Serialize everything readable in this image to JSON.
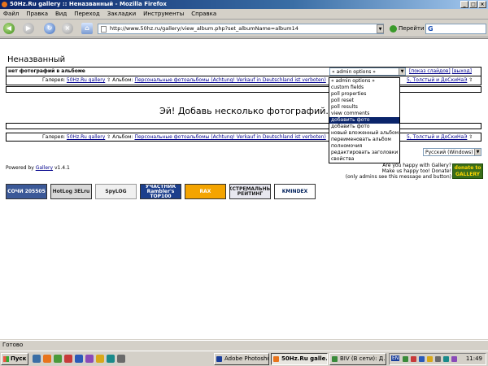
{
  "window": {
    "title": "50Hz.Ru gallery :: Неназванный - Mozilla Firefox"
  },
  "menu": [
    "Файл",
    "Правка",
    "Вид",
    "Переход",
    "Закладки",
    "Инструменты",
    "Справка"
  ],
  "navbar": {
    "url": "http://www.50hz.ru/gallery/view_album.php?set_albumName=album14",
    "go_label": "Перейти",
    "search_placeholder": ""
  },
  "page": {
    "title": "Неназванный",
    "album_empty_label": "нет фотографий в альбоме",
    "admin_select_value": "« admin options »",
    "slideshow_link": "[показ слайдов]",
    "logout_link": "[выход]",
    "breadcrumb": {
      "gallery_label": "Галерея:",
      "gallery_link": "50Hz.Ru gallery",
      "album_label": "Альбом:",
      "album_link": "Персональные фотоальбомы (Achtung! Verkauf in Deutschland ist verboten)",
      "end_link": "5, Толстый и ДоСкиНаЭ"
    },
    "empty_message": "Эй! Добавь несколько фотографий.",
    "admin_options": [
      "« admin options »",
      "custom fields",
      "poll properties",
      "poll reset",
      "poll results",
      "view comments",
      "добавить фото",
      "добавить фото",
      "новый вложенный альбом",
      "переименовать альбом",
      "полномочия",
      "редактировать заголовки",
      "свойства"
    ],
    "selected_option_index": 6,
    "language_select": "Русский (Windows)",
    "powered_by": "Powered by",
    "gallery_link": "Gallery",
    "gallery_version": "v1.4.1",
    "happy_lines": [
      "Are you happy with Gallery?",
      "Make us happy too! Donate!",
      "(only admins see this message and button)"
    ],
    "donate_label": "donate to GALLERY",
    "counters": [
      {
        "label": "СОЧИ 205505",
        "name": "counter-sochi"
      },
      {
        "label": "HotLog 3ELru",
        "name": "counter-hotlog"
      },
      {
        "label": "SpyLOG",
        "name": "counter-spylog"
      },
      {
        "label": "УЧАСТНИК Rambler's TOP100",
        "name": "counter-rambler"
      },
      {
        "label": "RAX",
        "name": "counter-rax"
      },
      {
        "label": "ЭКСТРЕМАЛЬНЫЙ РЕЙТИНГ",
        "name": "counter-extreme"
      },
      {
        "label": "KMINDEX",
        "name": "counter-kmindex"
      }
    ]
  },
  "status": "Готово",
  "taskbar": {
    "start": "Пуск",
    "tasks": [
      {
        "label": "Adobe Photoshop",
        "active": false
      },
      {
        "label": "50Hz.Ru galle...",
        "active": true
      },
      {
        "label": "BIV (В сети): Д...",
        "active": false
      }
    ],
    "lang": "EN",
    "clock": "11:49"
  },
  "colors": {
    "titlebar": "#0a246a",
    "link": "#00008b",
    "selected": "#0a246a"
  }
}
